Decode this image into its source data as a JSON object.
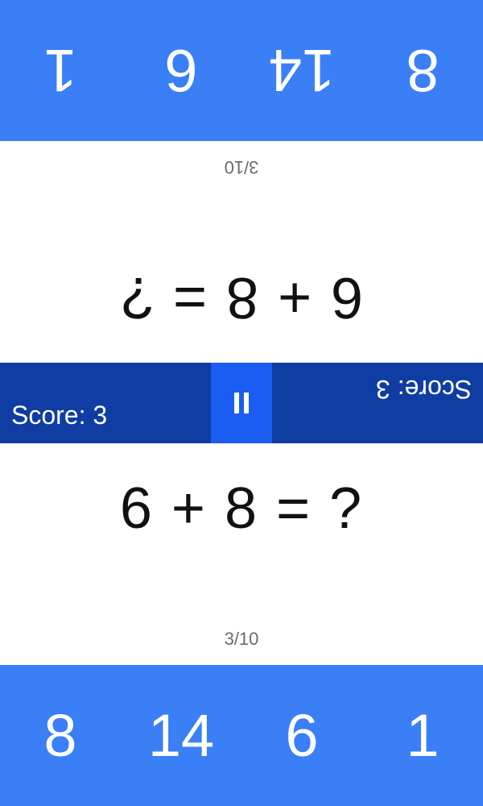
{
  "player_top": {
    "progress": "3/10",
    "question": "6 + 8 = ?",
    "answers": [
      "8",
      "14",
      "6",
      "1"
    ],
    "score_text": "Score: 3"
  },
  "player_bottom": {
    "progress": "3/10",
    "question": "6 + 8 = ?",
    "answers": [
      "8",
      "14",
      "6",
      "1"
    ],
    "score_text": "Score: 3"
  },
  "pause_icon": "pause-icon",
  "colors": {
    "answer_bar": "#3a7ff6",
    "middle_bar": "#0f3da3",
    "pause_button": "#1b5cf2",
    "background": "#ffffff"
  }
}
